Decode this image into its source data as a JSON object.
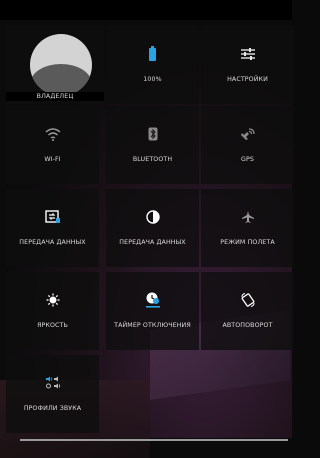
{
  "owner": {
    "label": "ВЛАДЕЛЕЦ"
  },
  "tiles": {
    "battery": {
      "label": "100%"
    },
    "settings": {
      "label": "НАСТРОЙКИ"
    },
    "wifi": {
      "label": "WI-FI"
    },
    "bluetooth": {
      "label": "BLUETOOTH"
    },
    "gps": {
      "label": "GPS"
    },
    "data_transfer_1": {
      "label": "ПЕРЕДАЧА ДАННЫХ"
    },
    "data_transfer_2": {
      "label": "ПЕРЕДАЧА ДАННЫХ"
    },
    "airplane": {
      "label": "РЕЖИМ ПОЛЕТА"
    },
    "brightness": {
      "label": "ЯРКОСТЬ"
    },
    "sleep_timer": {
      "label": "ТАЙМЕР ОТКЛЮЧЕНИЯ"
    },
    "autorotate": {
      "label": "АВТОПОВОРОТ"
    },
    "sound_profiles": {
      "label": "ПРОФИЛИ ЗВУКА"
    }
  },
  "colors": {
    "accent": "#29a3e4",
    "tile_bg": "#0e0e0e"
  },
  "icons": {
    "battery": "battery-full-icon",
    "settings": "sliders-icon",
    "wifi": "wifi-icon",
    "bluetooth": "bluetooth-icon",
    "gps": "gps-icon",
    "data_transfer_1": "sim-data-icon",
    "data_transfer_2": "data-saver-icon",
    "airplane": "airplane-icon",
    "brightness": "brightness-icon",
    "sleep_timer": "timer-icon",
    "autorotate": "rotate-icon",
    "sound_profiles": "volume-icon"
  }
}
